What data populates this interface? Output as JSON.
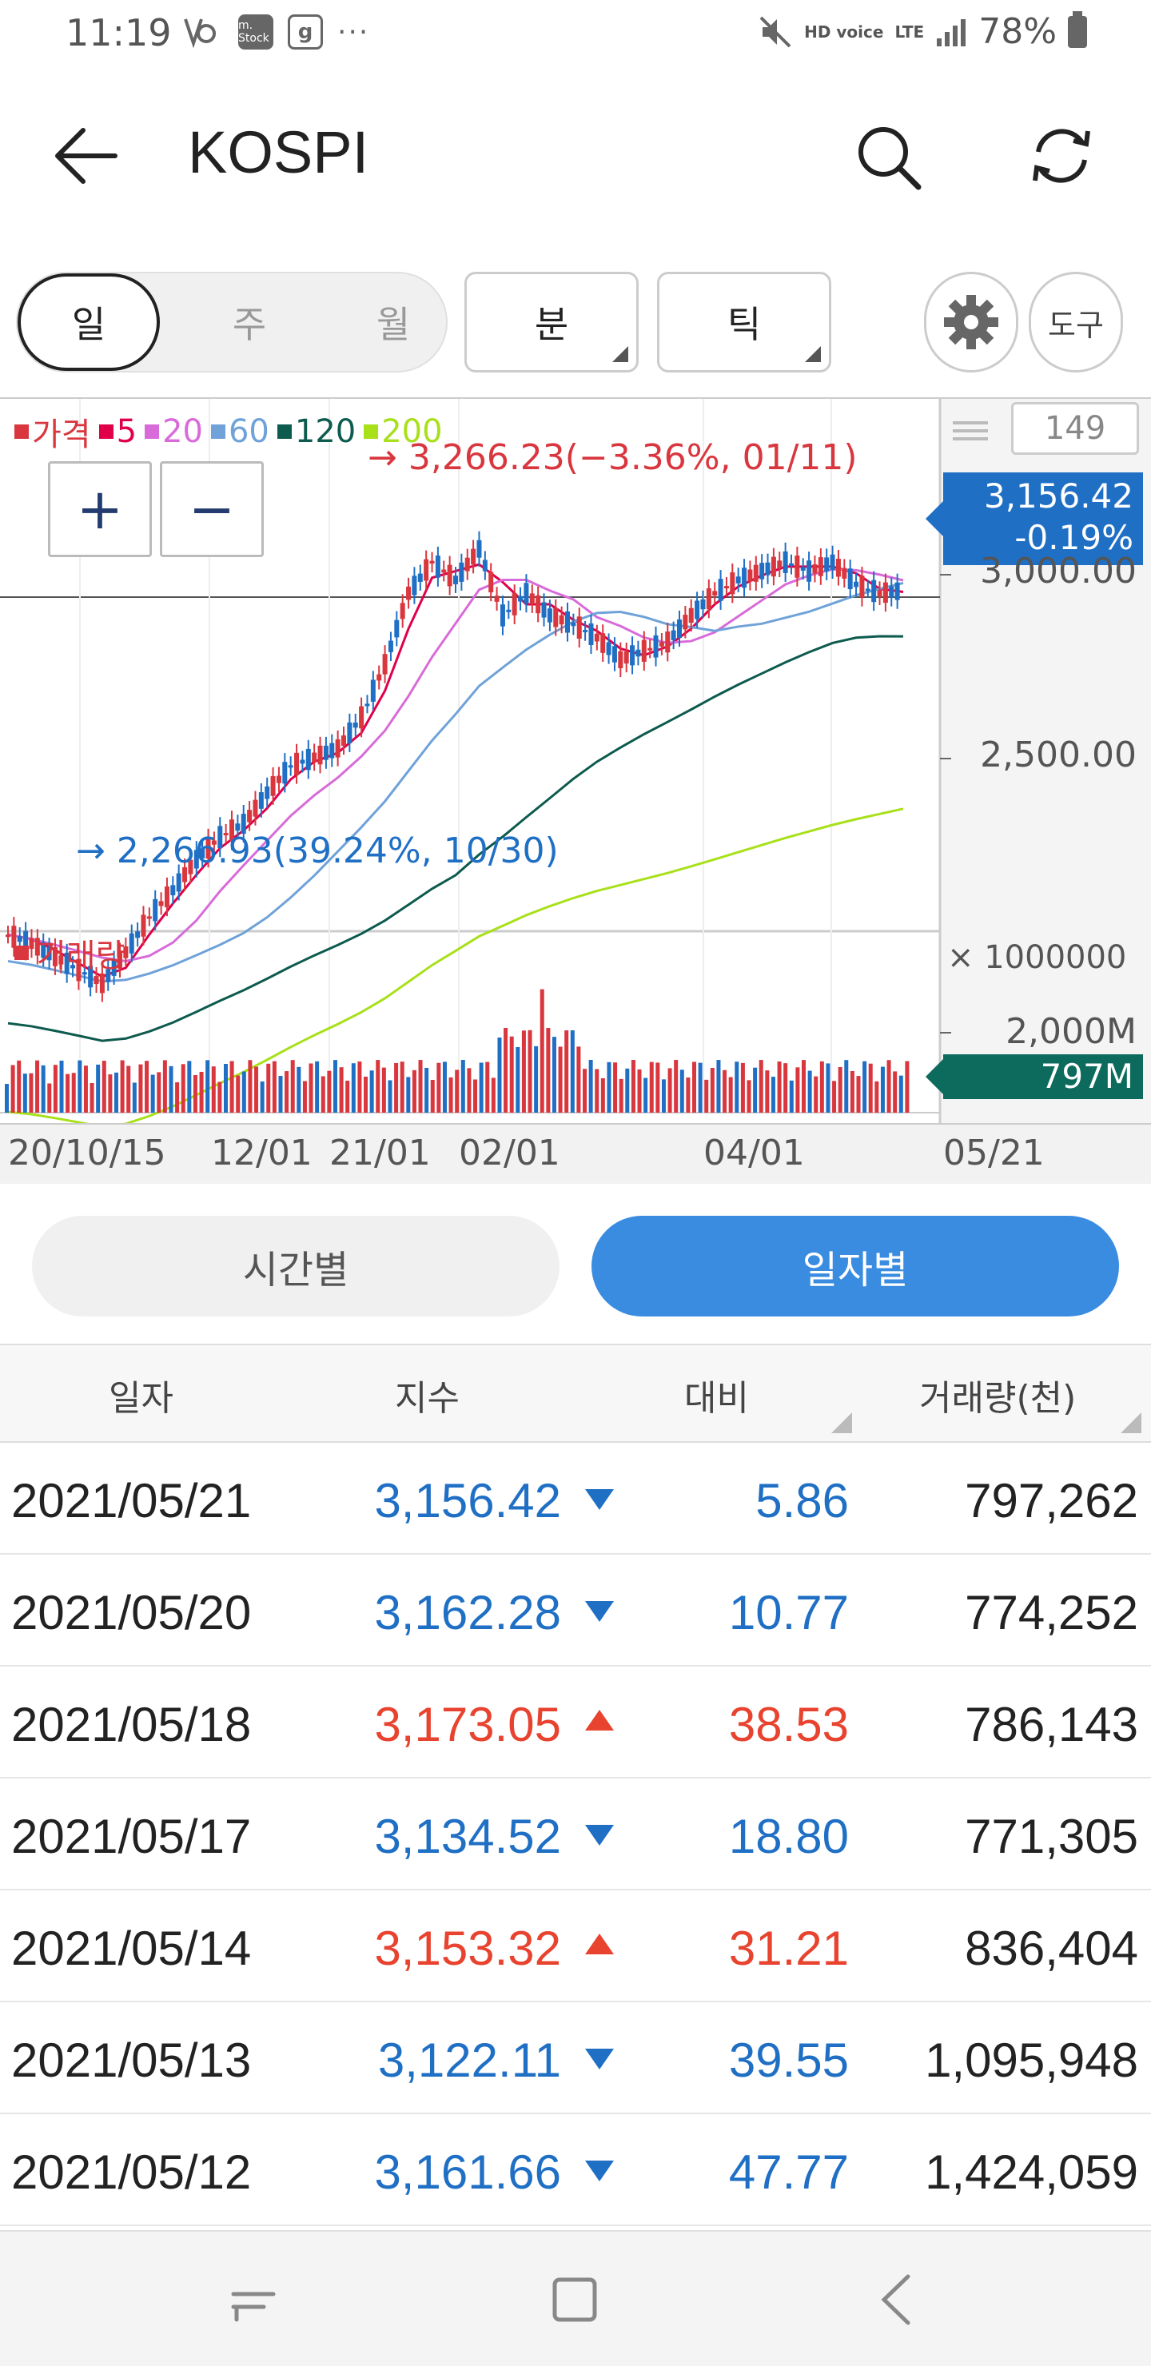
{
  "status": {
    "time": "11:19",
    "stock_icon": "m. Stock",
    "g_icon": "g",
    "dots": "···",
    "hd_voice": "HD voice",
    "lte": "LTE",
    "battery": "78%"
  },
  "header": {
    "title": "KOSPI"
  },
  "period": {
    "day": "일",
    "week": "주",
    "month": "월",
    "minute": "분",
    "tick": "틱",
    "tools": "도구"
  },
  "chart": {
    "legend": [
      {
        "label": "가격",
        "color": "#d9363e"
      },
      {
        "label": "5",
        "color": "#e0004a"
      },
      {
        "label": "20",
        "color": "#d86bd9"
      },
      {
        "label": "60",
        "color": "#6fa2d8"
      },
      {
        "label": "120",
        "color": "#0d5a4e"
      },
      {
        "label": "200",
        "color": "#a8e01a"
      }
    ],
    "high_annotation": "→ 3,266.23(−3.36%, 01/11)",
    "low_annotation": "→ 2,266.93(39.24%, 10/30)",
    "count": "149",
    "price_tag": [
      "3,156.42",
      "-0.19%"
    ],
    "y_labels": [
      "3,000.00",
      "2,500.00"
    ],
    "volume_title": "거래량",
    "volume_multiplier": "× 1000000",
    "volume_label": "2,000M",
    "volume_tag": "797M",
    "x_labels": [
      "20/10/15",
      "12/01",
      "21/01",
      "02/01",
      "04/01",
      "05/21"
    ],
    "zoom_in": "+",
    "zoom_out": "−"
  },
  "chart_data": {
    "type": "line",
    "title": "KOSPI",
    "x_range": [
      "2020/10/15",
      "2021/05/21"
    ],
    "series": [
      {
        "name": "가격",
        "values": [
          2380,
          2360,
          2330,
          2300,
          2270,
          2340,
          2420,
          2480,
          2550,
          2600,
          2630,
          2700,
          2760,
          2780,
          2800,
          2870,
          2990,
          3150,
          3220,
          3180,
          3250,
          3100,
          3150,
          3100,
          3080,
          3050,
          3000,
          3020,
          3040,
          3100,
          3150,
          3180,
          3200,
          3220,
          3200,
          3220,
          3170,
          3150,
          3156
        ]
      },
      {
        "name": "5"
      },
      {
        "name": "20"
      },
      {
        "name": "60"
      },
      {
        "name": "120"
      },
      {
        "name": "200"
      }
    ],
    "ylim": [
      2200,
      3300
    ],
    "reference_line": 3000,
    "high": {
      "value": 3266.23,
      "date": "01/11"
    },
    "low": {
      "value": 2266.93,
      "date": "10/30"
    }
  },
  "tabs": {
    "time": "시간별",
    "daily": "일자별"
  },
  "table": {
    "headers": [
      "일자",
      "지수",
      "대비",
      "거래량(천)"
    ],
    "rows": [
      {
        "date": "2021/05/21",
        "index": "3,156.42",
        "dir": "down",
        "change": "5.86",
        "volume": "797,262"
      },
      {
        "date": "2021/05/20",
        "index": "3,162.28",
        "dir": "down",
        "change": "10.77",
        "volume": "774,252"
      },
      {
        "date": "2021/05/18",
        "index": "3,173.05",
        "dir": "up",
        "change": "38.53",
        "volume": "786,143"
      },
      {
        "date": "2021/05/17",
        "index": "3,134.52",
        "dir": "down",
        "change": "18.80",
        "volume": "771,305"
      },
      {
        "date": "2021/05/14",
        "index": "3,153.32",
        "dir": "up",
        "change": "31.21",
        "volume": "836,404"
      },
      {
        "date": "2021/05/13",
        "index": "3,122.11",
        "dir": "down",
        "change": "39.55",
        "volume": "1,095,948"
      },
      {
        "date": "2021/05/12",
        "index": "3,161.66",
        "dir": "down",
        "change": "47.77",
        "volume": "1,424,059"
      }
    ]
  }
}
